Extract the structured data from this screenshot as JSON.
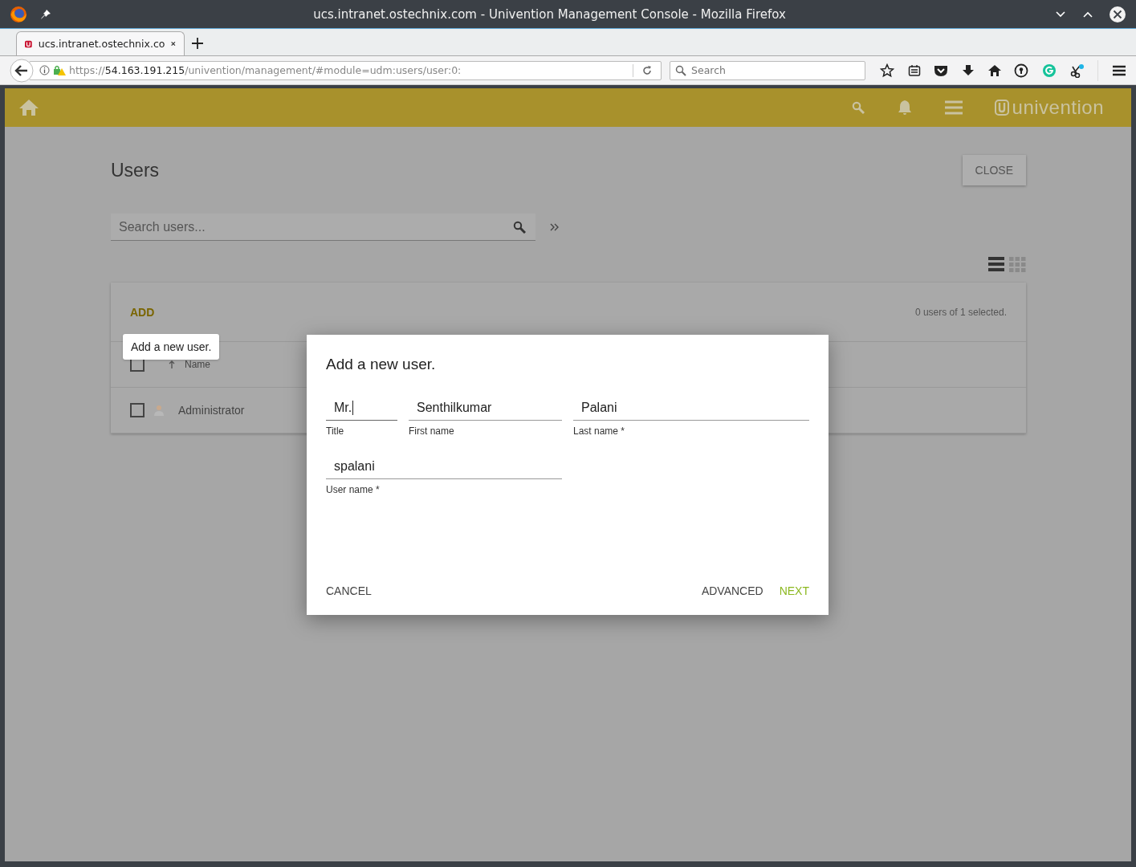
{
  "window": {
    "title": "ucs.intranet.ostechnix.com - Univention Management Console - Mozilla Firefox"
  },
  "tabs": [
    {
      "title": "ucs.intranet.ostechnix.co",
      "selected": true
    }
  ],
  "address_bar": {
    "scheme": "https://",
    "host": "54.163.191.215",
    "path": "/univention/management/#module=udm:users/user:0:"
  },
  "search": {
    "placeholder": "Search"
  },
  "app": {
    "brand": "univention",
    "page_title": "Users",
    "close_button": "CLOSE",
    "search": {
      "placeholder": "Search users..."
    },
    "view_modes": [
      {
        "kind": "list",
        "selected": true
      },
      {
        "kind": "grid",
        "selected": false
      }
    ],
    "add_button": "ADD",
    "selection_status": "0 users of 1 selected.",
    "tooltip": "Add a new user.",
    "table": {
      "columns": [
        {
          "label": "Name"
        }
      ],
      "header_checked": false,
      "rows": [
        {
          "name": "Administrator",
          "checked": false
        }
      ]
    }
  },
  "dialog": {
    "title": "Add a new user.",
    "fields": [
      {
        "label": "Title",
        "value": "Mr.",
        "focused": true
      },
      {
        "label": "First name",
        "value": "Senthilkumar",
        "focused": false
      },
      {
        "label": "Last name *",
        "value": "Palani",
        "focused": false
      },
      {
        "label": "User name *",
        "value": "spalani",
        "focused": false
      }
    ],
    "buttons": [
      {
        "label": "CANCEL",
        "kind": "plain"
      },
      {
        "label": "ADVANCED",
        "kind": "plain"
      },
      {
        "label": "NEXT",
        "kind": "primary"
      }
    ]
  }
}
